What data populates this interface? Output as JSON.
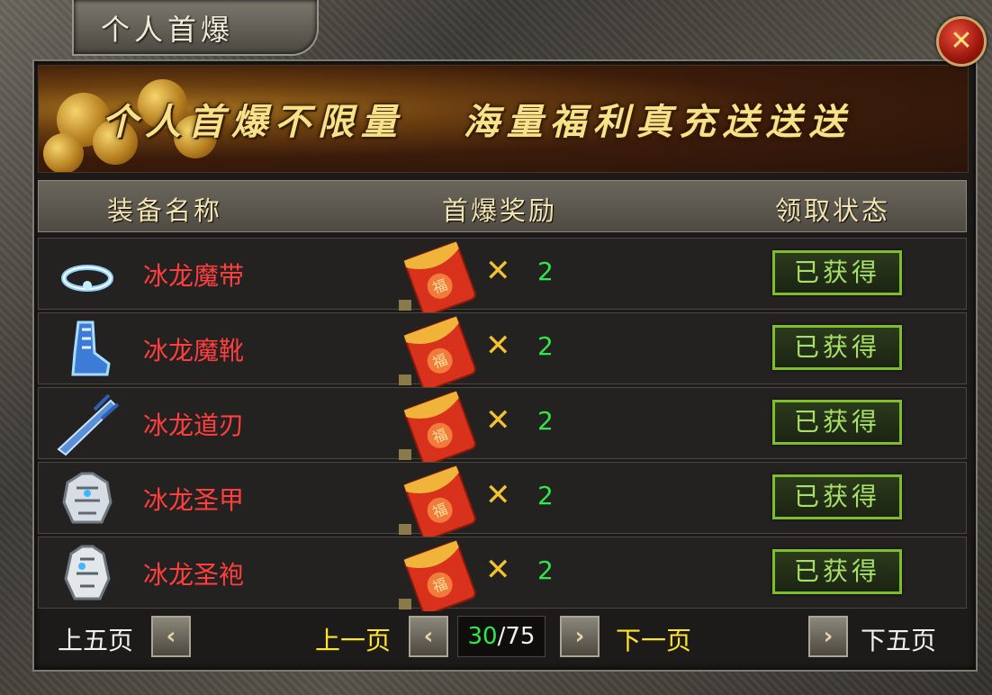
{
  "window": {
    "title": "个人首爆",
    "close_label": "✕"
  },
  "banner": {
    "text": "个人首爆不限量   海量福利真充送送送"
  },
  "table": {
    "headers": [
      "装备名称",
      "首爆奖励",
      "领取状态"
    ],
    "rows": [
      {
        "icon": "belt-icon",
        "name": "冰龙魔带",
        "times": "✕",
        "qty": "2",
        "status": "已获得"
      },
      {
        "icon": "boots-icon",
        "name": "冰龙魔靴",
        "times": "✕",
        "qty": "2",
        "status": "已获得"
      },
      {
        "icon": "blade-icon",
        "name": "冰龙道刃",
        "times": "✕",
        "qty": "2",
        "status": "已获得"
      },
      {
        "icon": "armor-icon",
        "name": "冰龙圣甲",
        "times": "✕",
        "qty": "2",
        "status": "已获得"
      },
      {
        "icon": "robe-icon",
        "name": "冰龙圣袍",
        "times": "✕",
        "qty": "2",
        "status": "已获得"
      }
    ]
  },
  "pagination": {
    "prev_five": "上五页",
    "prev_one": "上一页",
    "current": "30",
    "separator": "/",
    "total": "75",
    "next_one": "下一页",
    "next_five": "下五页",
    "left_arrow": "‹",
    "right_arrow": "›"
  },
  "colors": {
    "item_name": "#ff3e3e",
    "quantity": "#2fe84a",
    "status_border": "#7fbd2a",
    "page_nav_yellow": "#ffe42e"
  }
}
